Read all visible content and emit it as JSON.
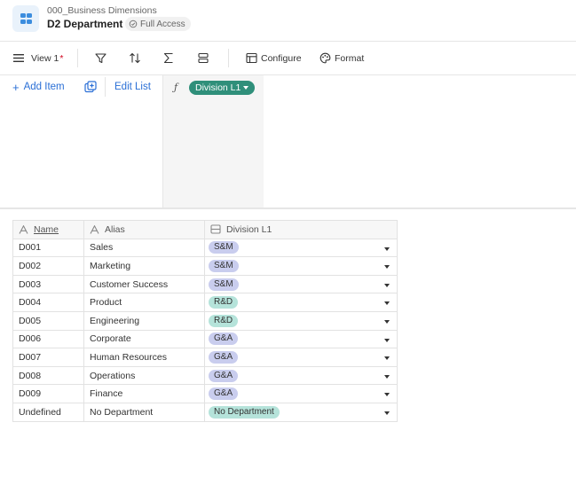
{
  "header": {
    "breadcrumb": "000_Business Dimensions",
    "title": "D2 Department",
    "access_badge": "Full Access",
    "app_icon": "grid-blocks-icon"
  },
  "toolbar": {
    "view_label": "View 1",
    "unsaved_marker": "*",
    "configure_label": "Configure",
    "format_label": "Format",
    "icons": [
      "menu-icon",
      "filter-icon",
      "sort-icon",
      "sum-icon",
      "rows-icon",
      "table-icon",
      "palette-icon"
    ]
  },
  "list_panel": {
    "add_item_label": "Add Item",
    "edit_list_label": "Edit List",
    "formula_symbol": "ƒ",
    "column_pill_label": "Division L1"
  },
  "grid": {
    "columns": [
      "Name",
      "Alias",
      "Division L1"
    ],
    "rows": [
      {
        "name": "D001",
        "alias": "Sales",
        "division": "S&M",
        "kind": "sm"
      },
      {
        "name": "D002",
        "alias": "Marketing",
        "division": "S&M",
        "kind": "sm"
      },
      {
        "name": "D003",
        "alias": "Customer Success",
        "division": "S&M",
        "kind": "sm"
      },
      {
        "name": "D004",
        "alias": "Product",
        "division": "R&D",
        "kind": "rd"
      },
      {
        "name": "D005",
        "alias": "Engineering",
        "division": "R&D",
        "kind": "rd"
      },
      {
        "name": "D006",
        "alias": "Corporate",
        "division": "G&A",
        "kind": "ga"
      },
      {
        "name": "D007",
        "alias": "Human Resources",
        "division": "G&A",
        "kind": "ga"
      },
      {
        "name": "D008",
        "alias": "Operations",
        "division": "G&A",
        "kind": "ga"
      },
      {
        "name": "D009",
        "alias": "Finance",
        "division": "G&A",
        "kind": "ga"
      },
      {
        "name": "Undefined",
        "alias": "No Department",
        "division": "No Department",
        "kind": "nd"
      }
    ]
  },
  "colors": {
    "accent_blue": "#2a6fd6",
    "pill_green": "#2f8f7a",
    "chip_sm": "#c9cdee",
    "chip_rd": "#b5e3da",
    "chip_ga": "#c9cdee",
    "chip_nd": "#b5e3da"
  }
}
